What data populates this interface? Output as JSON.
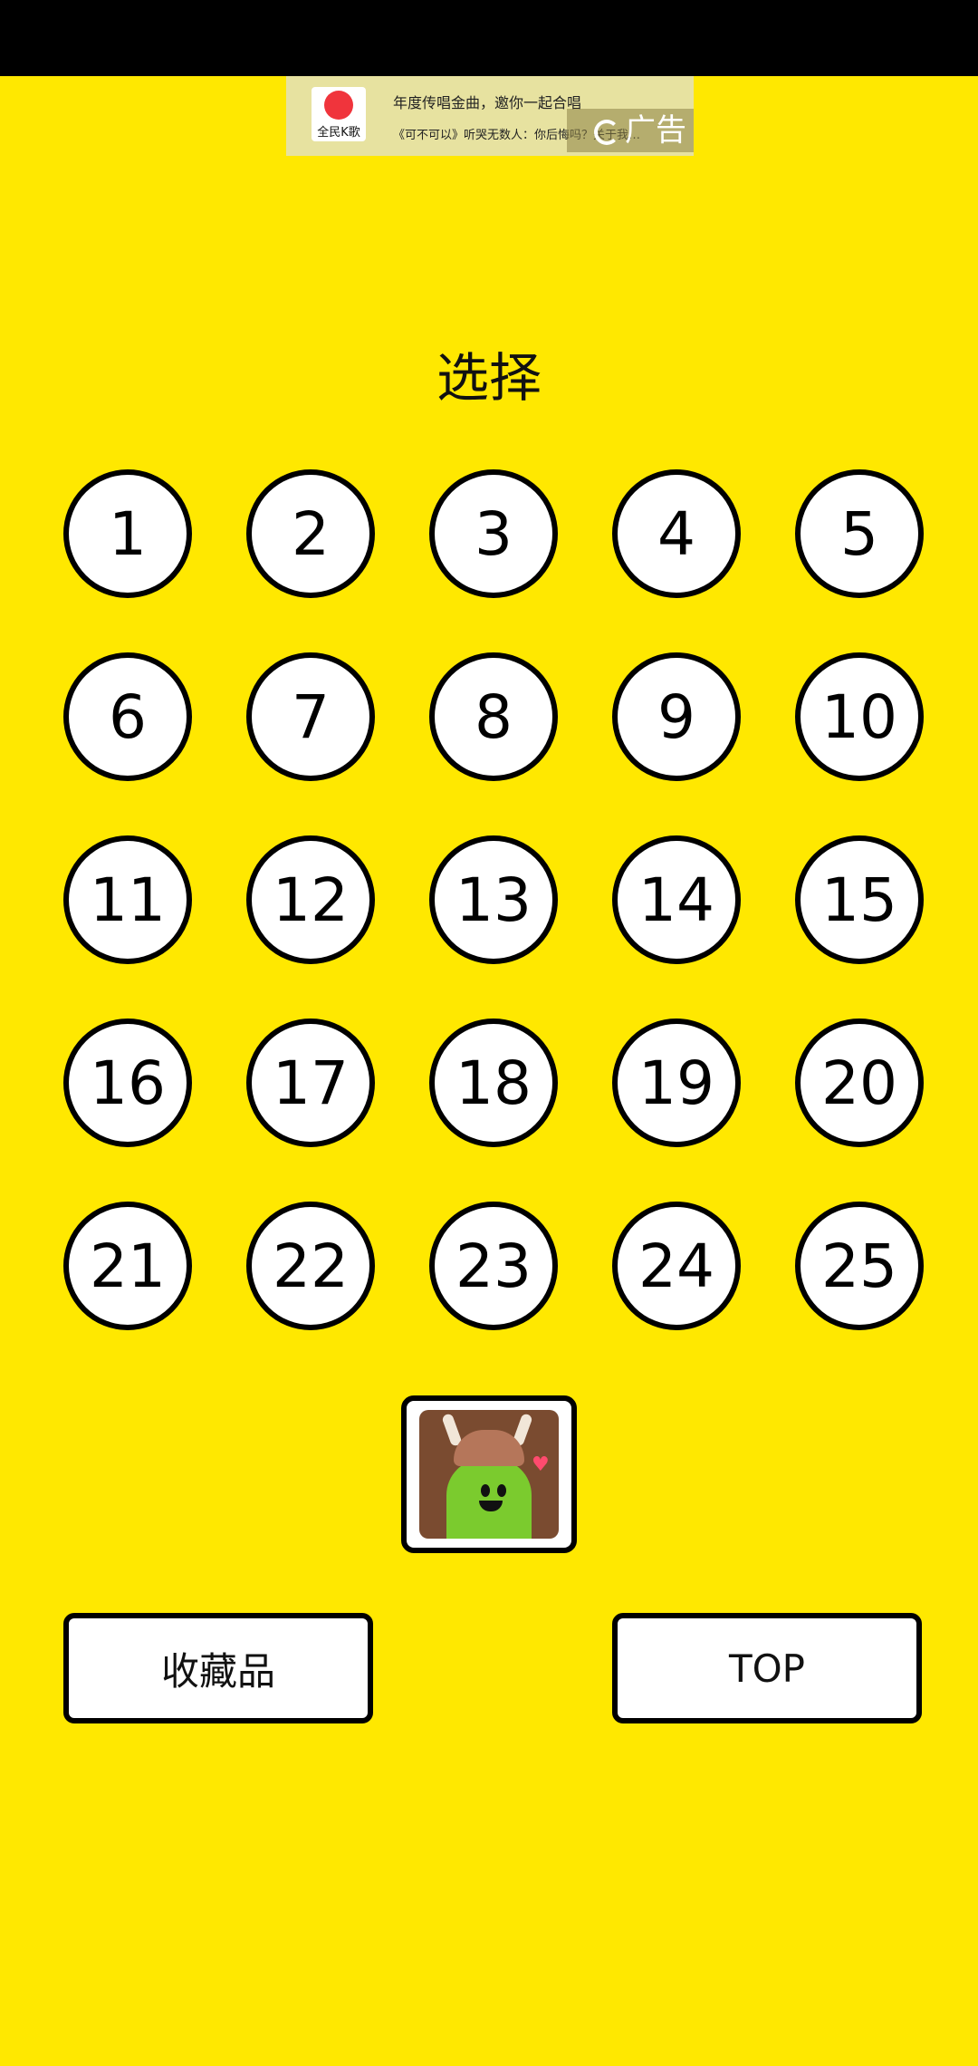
{
  "ad": {
    "logo_text": "全民K歌",
    "line1": "年度传唱金曲，邀你一起合唱",
    "line2": "《可不可以》听哭无数人：你后悔吗？关于我…",
    "tag": "广告"
  },
  "page": {
    "title": "选择"
  },
  "levels": [
    "1",
    "2",
    "3",
    "4",
    "5",
    "6",
    "7",
    "8",
    "9",
    "10",
    "11",
    "12",
    "13",
    "14",
    "15",
    "16",
    "17",
    "18",
    "19",
    "20",
    "21",
    "22",
    "23",
    "24",
    "25"
  ],
  "buttons": {
    "collection": "收藏品",
    "top": "TOP"
  },
  "colors": {
    "background": "#FFE800",
    "status_bar": "#000000",
    "button_fill": "#FFFFFF",
    "outline": "#000000"
  }
}
